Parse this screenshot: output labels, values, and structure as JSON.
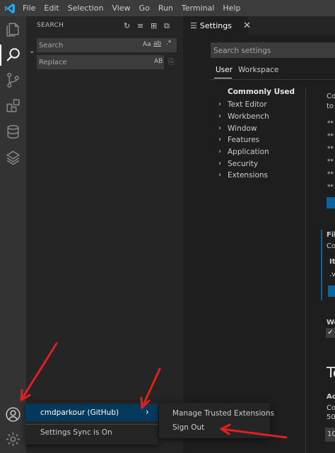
{
  "menu": [
    "File",
    "Edit",
    "Selection",
    "View",
    "Go",
    "Run",
    "Terminal",
    "Help"
  ],
  "sidebar": {
    "title": "SEARCH",
    "search_placeholder": "Search",
    "search_opt_case": "Aa",
    "search_opt_word": "ab",
    "search_opt_regex": ".*",
    "replace_placeholder": "Replace",
    "replace_opt": "AB"
  },
  "tab": {
    "label": "Settings"
  },
  "settings": {
    "search_placeholder": "Search settings",
    "scope_user": "User",
    "scope_workspace": "Workspace",
    "toc_common": "Commonly Used",
    "toc_items": [
      "Text Editor",
      "Workbench",
      "Window",
      "Features",
      "Application",
      "Security",
      "Extensions"
    ],
    "content_snippets": [
      "Co",
      "to",
      "Fil",
      "Co",
      "It",
      ".v",
      "We",
      "Te",
      "Ac",
      "Co",
      "50",
      "10"
    ]
  },
  "account_menu": {
    "account_label": "cmdparkour (GitHub)",
    "sync_label": "Settings Sync is On"
  },
  "account_submenu": {
    "manage_label": "Manage Trusted Extensions",
    "signout_label": "Sign Out"
  },
  "colors": {
    "titlebar": "#3c3c3c",
    "activitybar": "#333333",
    "sidebar": "#252526",
    "editor": "#1e1e1e",
    "accent": "#0e639c",
    "menu_selected": "#04395e",
    "annotation_arrow": "#e02020"
  },
  "icons": [
    "vscode-logo-icon",
    "explorer-icon",
    "search-icon",
    "source-control-icon",
    "extensions-icon",
    "database-icon",
    "layers-icon",
    "account-icon",
    "gear-icon"
  ]
}
